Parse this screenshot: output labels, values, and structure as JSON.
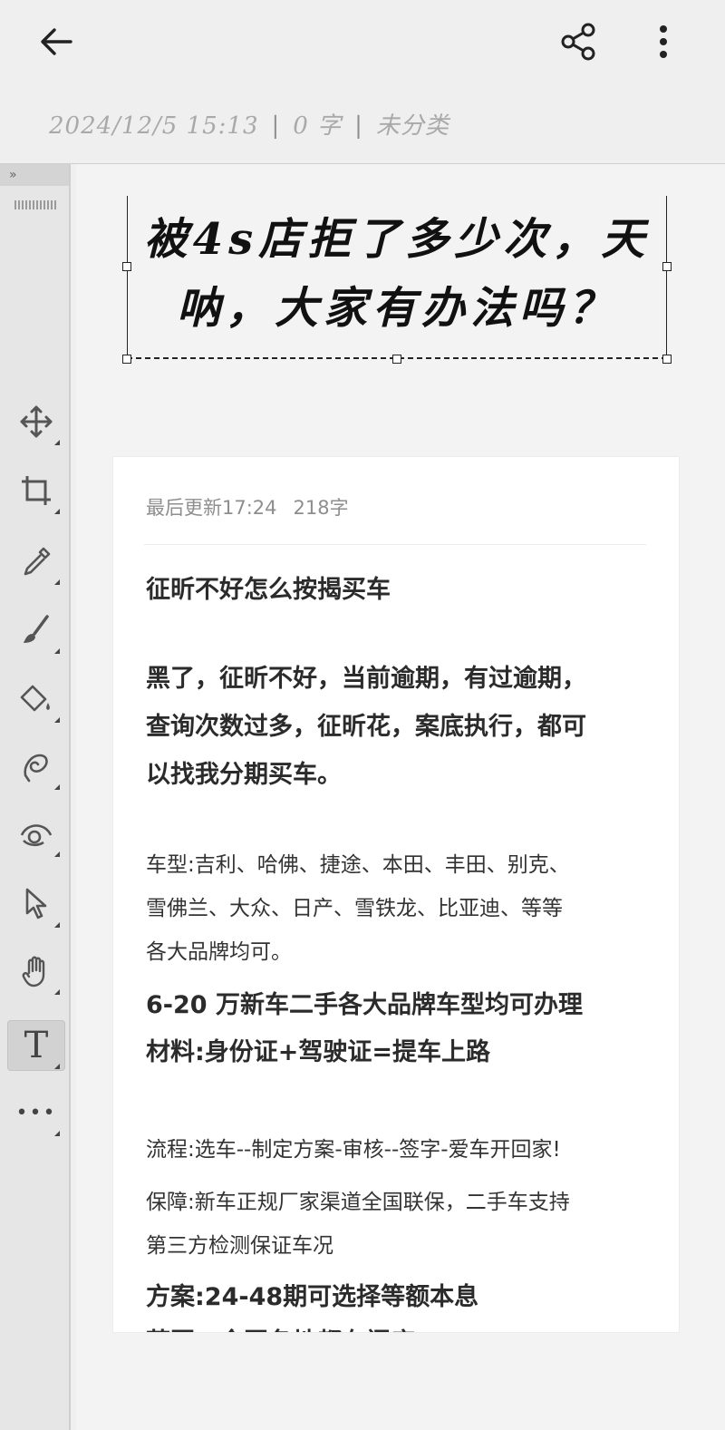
{
  "header": {
    "timestamp": "2024/12/5 15:13",
    "word_count": "0 字",
    "category": "未分类",
    "icons": [
      "back-arrow-icon",
      "share-icon",
      "more-vert-icon"
    ]
  },
  "toolbar": {
    "collapse_label": "»",
    "tools": [
      "move-icon",
      "crop-icon",
      "eyedropper-icon",
      "brush-icon",
      "paint-bucket-icon",
      "lasso-icon",
      "eye-icon",
      "select-arrow-icon",
      "hand-icon",
      "text-tool-icon",
      "more-tools-icon"
    ],
    "active_tool": "text-tool-icon",
    "text_tool_label": "T",
    "more_label": "•••"
  },
  "canvas": {
    "title_line1": "被4s店拒了多少次，天",
    "title_line2": "呐，大家有办法吗？"
  },
  "note": {
    "updated": "最后更新17:24",
    "char_count": "218字",
    "heading": "征昕不好怎么按揭买车",
    "pitch": [
      "黑了，征昕不好，当前逾期，有过逾期，",
      "查询次数过多，征昕花，案底执行，都可",
      "以找我分期买车。"
    ],
    "models": [
      "车型:吉利、哈佛、捷途、本田、丰田、别克、",
      "雪佛兰、大众、日产、雪铁龙、比亚迪、等等",
      "各大品牌均可。"
    ],
    "price_line": "6-20 万新车二手各大品牌车型均可办理",
    "materials_line": "材料:身份证+驾驶证=提车上路",
    "process": "流程:选车--制定方案-审核--签字-爱车开回家!",
    "guarantee": [
      "保障:新车正规厂家渠道全国联保，二手车支持",
      "第三方检测保证车况"
    ],
    "plan": "方案:24-48期可选择等额本息",
    "cutoff": "范围：全国各地都有门店"
  }
}
